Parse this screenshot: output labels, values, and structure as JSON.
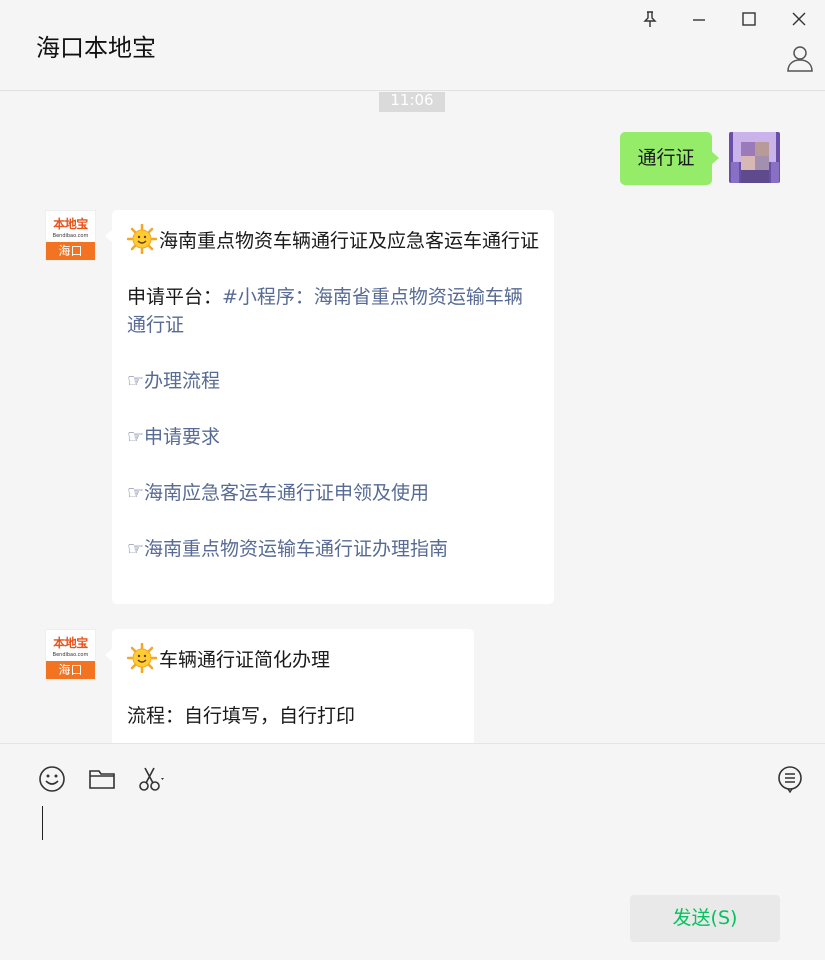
{
  "window": {
    "title": "海口本地宝"
  },
  "window_controls": [
    "pin-icon",
    "minimize-icon",
    "maximize-icon",
    "close-icon"
  ],
  "chat": {
    "timestamp": "11:06",
    "sent_message": "通行证",
    "messages": [
      {
        "sender_logo": {
          "brand": "本地宝",
          "site": "Bendibao.com",
          "city": "海口"
        },
        "title": "海南重点物资车辆通行证及应急客运车通行证",
        "platform_label": "申请平台：",
        "platform_link": "#小程序：海南省重点物资运输车辆通行证",
        "links": [
          "☞办理流程",
          "☞申请要求",
          "☞海南应急客运车通行证申领及使用",
          "☞海南重点物资运输车通行证办理指南"
        ]
      },
      {
        "sender_logo": {
          "brand": "本地宝",
          "site": "Bendibao.com",
          "city": "海口"
        },
        "title": "车辆通行证简化办理",
        "process": "流程：自行填写，自行打印"
      }
    ]
  },
  "toolbar": {
    "tools": [
      "emoji-icon",
      "folder-icon",
      "scissors-icon",
      "chat-history-icon"
    ]
  },
  "composer": {
    "send_label": "发送(S)"
  },
  "colors": {
    "sent_bubble": "#95ec69",
    "link": "#576b95",
    "send_text": "#07c160",
    "logo_orange": "#f27321"
  }
}
